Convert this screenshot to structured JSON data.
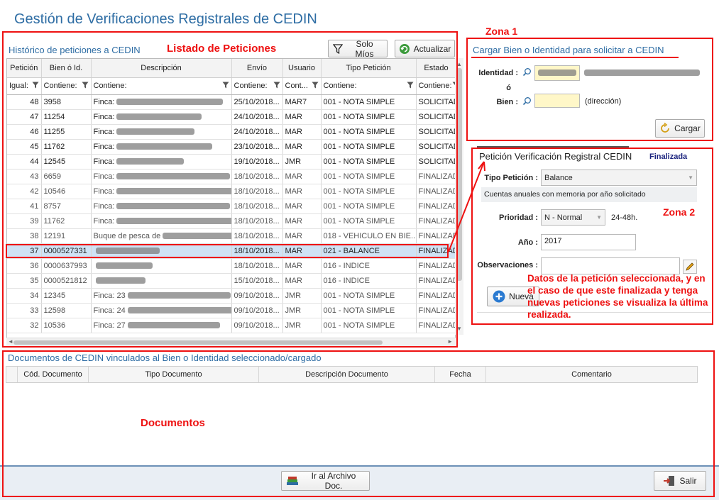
{
  "app": {
    "title": "Gestión de Verificaciones Registrales de CEDIN"
  },
  "annotations": {
    "listado": "Listado de Peticiones",
    "zona1": "Zona 1",
    "zona2": "Zona 2",
    "documentos": "Documentos",
    "zona2_note": "Datos de la petición seleccionada, y en el caso de que este finalizada y tenga nuevas peticiones se visualiza la última realizada."
  },
  "historico": {
    "title": "Histórico de peticiones a CEDIN",
    "solo_mios": "Solo Míos",
    "actualizar": "Actualizar",
    "columns": [
      "Petición",
      "Bien ó Id.",
      "Descripción",
      "Envío",
      "Usuario",
      "Tipo Petición",
      "Estado"
    ],
    "filters": [
      "Igual:",
      "Contiene:",
      "Contiene:",
      "Contiene:",
      "Cont...",
      "Contiene:",
      "Contiene:"
    ],
    "rows": [
      {
        "peticion": "48",
        "bien": "3958",
        "desc": "Finca:",
        "envio": "25/10/2018...",
        "usuario": "MAR7",
        "tipo": "001 - NOTA SIMPLE",
        "estado": "SOLICITAD..."
      },
      {
        "peticion": "47",
        "bien": "11254",
        "desc": "Finca:",
        "envio": "24/10/2018...",
        "usuario": "MAR",
        "tipo": "001 - NOTA SIMPLE",
        "estado": "SOLICITAD..."
      },
      {
        "peticion": "46",
        "bien": "11255",
        "desc": "Finca:",
        "envio": "24/10/2018...",
        "usuario": "MAR",
        "tipo": "001 - NOTA SIMPLE",
        "estado": "SOLICITAD..."
      },
      {
        "peticion": "45",
        "bien": "11762",
        "desc": "Finca:",
        "envio": "23/10/2018...",
        "usuario": "MAR",
        "tipo": "001 - NOTA SIMPLE",
        "estado": "SOLICITAD..."
      },
      {
        "peticion": "44",
        "bien": "12545",
        "desc": "Finca:",
        "envio": "19/10/2018...",
        "usuario": "JMR",
        "tipo": "001 - NOTA SIMPLE",
        "estado": "SOLICITAD..."
      },
      {
        "peticion": "43",
        "bien": "6659",
        "desc": "Finca:",
        "envio": "18/10/2018...",
        "usuario": "MAR",
        "tipo": "001 - NOTA SIMPLE",
        "estado": "FINALIZAD..."
      },
      {
        "peticion": "42",
        "bien": "10546",
        "desc": "Finca:",
        "envio": "18/10/2018...",
        "usuario": "MAR",
        "tipo": "001 - NOTA SIMPLE",
        "estado": "FINALIZAD..."
      },
      {
        "peticion": "41",
        "bien": "8757",
        "desc": "Finca:",
        "envio": "18/10/2018...",
        "usuario": "MAR",
        "tipo": "001 - NOTA SIMPLE",
        "estado": "FINALIZAD..."
      },
      {
        "peticion": "39",
        "bien": "11762",
        "desc": "Finca:",
        "envio": "18/10/2018...",
        "usuario": "MAR",
        "tipo": "001 - NOTA SIMPLE",
        "estado": "FINALIZAD..."
      },
      {
        "peticion": "38",
        "bien": "12191",
        "desc": "Buque de pesca de",
        "envio": "18/10/2018...",
        "usuario": "MAR",
        "tipo": "018 - VEHICULO EN BIE...",
        "estado": "FINALIZAD..."
      },
      {
        "peticion": "37",
        "bien": "0000527331",
        "desc": "",
        "envio": "18/10/2018...",
        "usuario": "MAR",
        "tipo": "021 - BALANCE",
        "estado": "FINALIZAD..."
      },
      {
        "peticion": "36",
        "bien": "0000637993",
        "desc": "",
        "envio": "18/10/2018...",
        "usuario": "MAR",
        "tipo": "016 - INDICE",
        "estado": "FINALIZAD..."
      },
      {
        "peticion": "35",
        "bien": "0000521812",
        "desc": "",
        "envio": "15/10/2018...",
        "usuario": "MAR",
        "tipo": "016 - INDICE",
        "estado": "FINALIZAD..."
      },
      {
        "peticion": "34",
        "bien": "12345",
        "desc": "Finca: 23",
        "envio": "09/10/2018...",
        "usuario": "JMR",
        "tipo": "001 - NOTA SIMPLE",
        "estado": "FINALIZAD..."
      },
      {
        "peticion": "33",
        "bien": "12598",
        "desc": "Finca: 24",
        "envio": "09/10/2018...",
        "usuario": "JMR",
        "tipo": "001 - NOTA SIMPLE",
        "estado": "FINALIZAD..."
      },
      {
        "peticion": "32",
        "bien": "10536",
        "desc": "Finca: 27",
        "envio": "09/10/2018...",
        "usuario": "JMR",
        "tipo": "001 - NOTA SIMPLE",
        "estado": "FINALIZAD..."
      }
    ]
  },
  "cargar": {
    "title": "Cargar Bien o Identidad para solicitar a CEDIN",
    "identidad_label": "Identidad :",
    "o_label": "ó",
    "bien_label": "Bien :",
    "direccion": "(dirección)",
    "cargar_button": "Cargar"
  },
  "peticion": {
    "title": "Petición Verificación Registral CEDIN",
    "status": "Finalizada",
    "tipo_label": "Tipo Petición :",
    "tipo_value": "Balance",
    "tipo_desc": "Cuentas anuales con memoria por año solicitado",
    "prioridad_label": "Prioridad :",
    "prioridad_value": "N - Normal",
    "prioridad_extra": "24-48h.",
    "anio_label": "Año :",
    "anio_value": "2017",
    "observaciones_label": "Observaciones :",
    "nueva_button": "Nueva"
  },
  "documentos": {
    "title": "Documentos de CEDIN vinculados al Bien o Identidad seleccionado/cargado",
    "columns": [
      "Cód. Documento",
      "Tipo Documento",
      "Descripción Documento",
      "Fecha",
      "Comentario"
    ]
  },
  "footer": {
    "archivo_button": "Ir al Archivo Doc.",
    "salir_button": "Salir"
  },
  "colors": {
    "accent": "#2e6da4",
    "annotation": "#e11111",
    "selected_row": "#cfe3f5"
  }
}
